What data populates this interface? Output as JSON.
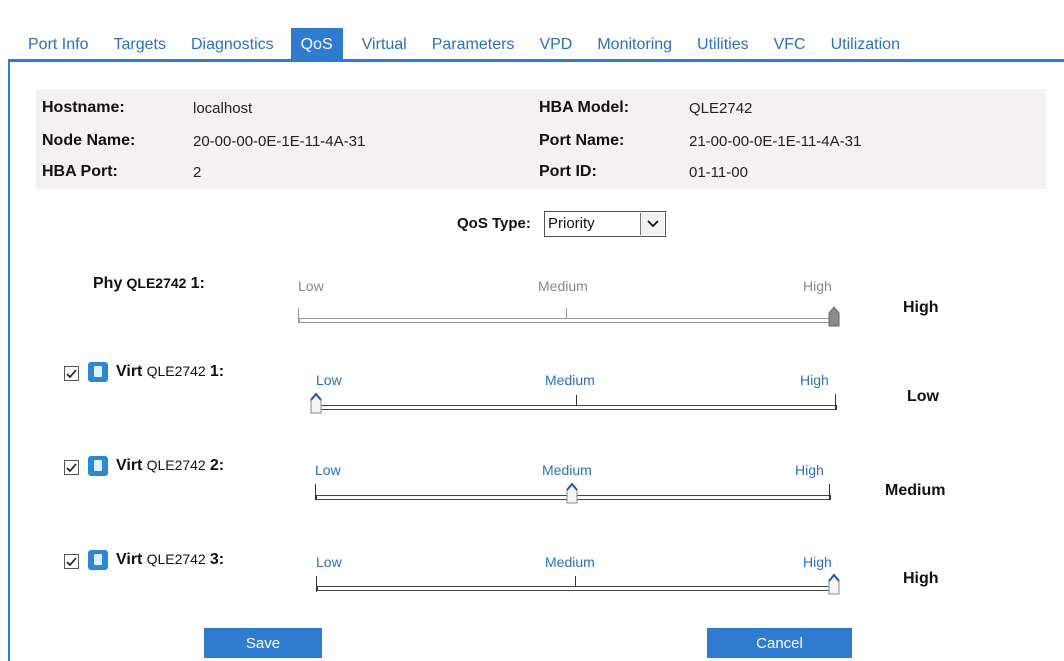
{
  "tabs": [
    "Port Info",
    "Targets",
    "Diagnostics",
    "QoS",
    "Virtual",
    "Parameters",
    "VPD",
    "Monitoring",
    "Utilities",
    "VFC",
    "Utilization"
  ],
  "active_tab": "QoS",
  "info": {
    "hostname_label": "Hostname:",
    "hostname": "localhost",
    "node_name_label": "Node Name:",
    "node_name": "20-00-00-0E-1E-11-4A-31",
    "hba_port_label": "HBA Port:",
    "hba_port": "2",
    "hba_model_label": "HBA Model:",
    "hba_model": "QLE2742",
    "port_name_label": "Port Name:",
    "port_name": "21-00-00-0E-1E-11-4A-31",
    "port_id_label": "Port ID:",
    "port_id": "01-11-00"
  },
  "qos_type": {
    "label": "QoS Type:",
    "value": "Priority"
  },
  "scale": {
    "low": "Low",
    "medium": "Medium",
    "high": "High"
  },
  "rows": [
    {
      "kind": "Phy",
      "model": "QLE2742",
      "index": "1:",
      "level": "High",
      "position": 1.0,
      "enabled": false
    },
    {
      "kind": "Virt",
      "model": "QLE2742",
      "index": "1:",
      "level": "Low",
      "position": 0.0,
      "checked": true
    },
    {
      "kind": "Virt",
      "model": "QLE2742",
      "index": "2:",
      "level": "Medium",
      "position": 0.5,
      "checked": true
    },
    {
      "kind": "Virt",
      "model": "QLE2742",
      "index": "3:",
      "level": "High",
      "position": 1.0,
      "checked": true
    }
  ],
  "buttons": {
    "save": "Save",
    "cancel": "Cancel"
  },
  "colors": {
    "accent": "#2f7bd0",
    "link": "#2d6fb4",
    "panel": "#f5f0f2"
  },
  "icons": {
    "virtual_port": "virtual-port-icon",
    "dropdown": "chevron-down-icon",
    "checkmark": "checkmark-icon"
  }
}
